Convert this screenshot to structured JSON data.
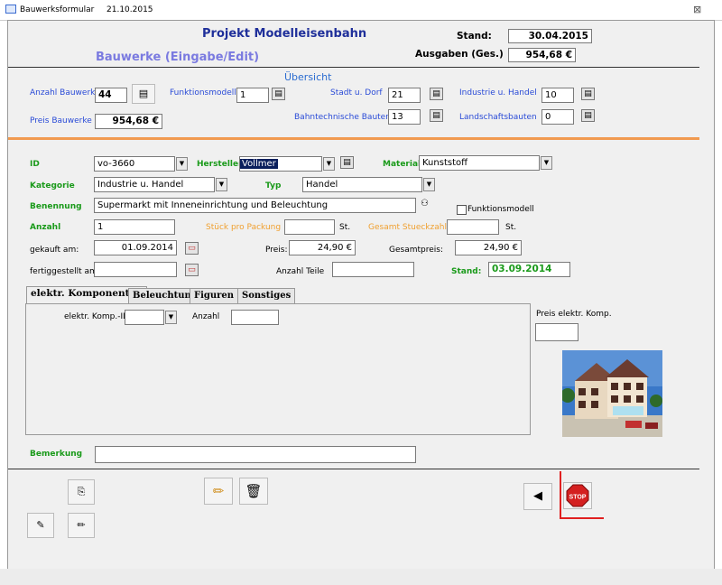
{
  "window": {
    "title": "Bauwerksformular",
    "date": "21.10.2015",
    "close_icon": "⊠"
  },
  "header": {
    "title": "Projekt Modelleisenbahn",
    "subtitle": "Bauwerke (Eingabe/Edit)",
    "stand_label": "Stand:",
    "stand_value": "30.04.2015",
    "ausgaben_label": "Ausgaben (Ges.)",
    "ausgaben_value": "954,68 €"
  },
  "overview": {
    "title": "Übersicht",
    "anzahl_bauwerke_label": "Anzahl Bauwerke",
    "anzahl_bauwerke_value": "44",
    "preis_bauwerke_label": "Preis Bauwerke",
    "preis_bauwerke_value": "954,68 €",
    "funktionsmodelle_label": "Funktionsmodelle",
    "funktionsmodelle_value": "1",
    "stadt_dorf_label": "Stadt u. Dorf",
    "stadt_dorf_value": "21",
    "bahntechnische_label": "Bahntechnische Bauten",
    "bahntechnische_value": "13",
    "industrie_label": "Industrie u. Handel",
    "industrie_value": "10",
    "landschaft_label": "Landschaftsbauten",
    "landschaft_value": "0"
  },
  "detail": {
    "id_label": "ID",
    "id_value": "vo-3660",
    "hersteller_label": "Hersteller",
    "hersteller_value": "Vollmer",
    "material_label": "Material",
    "material_value": "Kunststoff",
    "kategorie_label": "Kategorie",
    "kategorie_value": "Industrie u. Handel",
    "typ_label": "Typ",
    "typ_value": "Handel",
    "benennung_label": "Benennung",
    "benennung_value": "Supermarkt mit Inneneinrichtung und Beleuchtung",
    "funktionsmodell_label": "Funktionsmodell",
    "anzahl_label": "Anzahl",
    "anzahl_value": "1",
    "stueck_label": "Stück pro Packung",
    "stueck_unit": "St.",
    "gesamt_stueck_label": "Gesamt Stueckzahl",
    "gesamt_stueck_unit": "St.",
    "gekauft_label": "gekauft am:",
    "gekauft_value": "01.09.2014",
    "preis_label": "Preis:",
    "preis_value": "24,90 €",
    "gesamtpreis_label": "Gesamtpreis:",
    "gesamtpreis_value": "24,90 €",
    "fertig_label": "fertiggestellt am:",
    "anzahl_teile_label": "Anzahl Teile",
    "stand_label": "Stand:",
    "stand_value": "03.09.2014"
  },
  "tabs": [
    "elektr. Komponenten",
    "Beleuchtung",
    "Figuren",
    "Sonstiges"
  ],
  "tabpane": {
    "komp_id_label": "elektr. Komp.-ID",
    "anzahl_label": "Anzahl",
    "preis_komp_label": "Preis elektr. Komp."
  },
  "bemerkung_label": "Bemerkung",
  "buttons": {
    "copy_icon": "⎘",
    "edit_icon": "✎",
    "pencil_icon": "✏",
    "trash_icon": "🗑",
    "back_icon": "◀",
    "stop_label": "STOP",
    "book_icon": "▤",
    "binoculars_icon": "⚇",
    "calendar_icon": "▭",
    "dropdown_icon": "▼"
  }
}
